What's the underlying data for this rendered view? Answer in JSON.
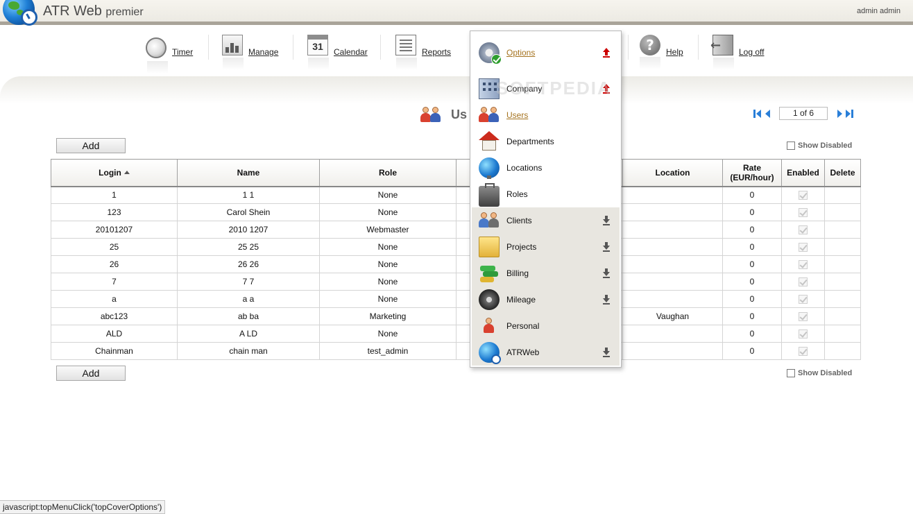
{
  "app": {
    "title": "ATR Web",
    "title_suffix": "premier",
    "user": "admin admin"
  },
  "nav": {
    "timer": "Timer",
    "manage": "Manage",
    "calendar": "Calendar",
    "calendar_day": "31",
    "reports": "Reports",
    "options": "Options",
    "help": "Help",
    "help_glyph": "?",
    "logoff": "Log off"
  },
  "page": {
    "title": "Us"
  },
  "pager": {
    "value": "1 of 6"
  },
  "actions": {
    "add_label": "Add",
    "show_disabled_label": "Show Disabled"
  },
  "table": {
    "headers": {
      "login": "Login",
      "name": "Name",
      "role": "Role",
      "location": "Location",
      "rate_line1": "Rate",
      "rate_line2": "(EUR/hour)",
      "enabled": "Enabled",
      "delete": "Delete"
    },
    "rows": [
      {
        "login": "1",
        "name": "1 1",
        "role": "None",
        "location": "",
        "rate": "0"
      },
      {
        "login": "123",
        "name": "Carol Shein",
        "role": "None",
        "location": "",
        "rate": "0"
      },
      {
        "login": "20101207",
        "name": "2010 1207",
        "role": "Webmaster",
        "location": "",
        "rate": "0"
      },
      {
        "login": "25",
        "name": "25 25",
        "role": "None",
        "location": "",
        "rate": "0"
      },
      {
        "login": "26",
        "name": "26 26",
        "role": "None",
        "location": "",
        "rate": "0"
      },
      {
        "login": "7",
        "name": "7 7",
        "role": "None",
        "location": "",
        "rate": "0"
      },
      {
        "login": "a",
        "name": "a a",
        "role": "None",
        "location": "",
        "rate": "0"
      },
      {
        "login": "abc123",
        "name": "ab ba",
        "role": "Marketing",
        "location": "Vaughan",
        "rate": "0"
      },
      {
        "login": "ALD",
        "name": "A LD",
        "role": "None",
        "location": "",
        "rate": "0"
      },
      {
        "login": "Chainman",
        "name": "chain man",
        "role": "test_admin",
        "location": "",
        "rate": "0"
      }
    ]
  },
  "options_menu": {
    "items": [
      {
        "label": "Options",
        "icon": "gear-check-icon"
      },
      {
        "label": "Company",
        "icon": "building-icon"
      },
      {
        "label": "Users",
        "icon": "users-icon"
      },
      {
        "label": "Departments",
        "icon": "house-icon"
      },
      {
        "label": "Locations",
        "icon": "globe-icon"
      },
      {
        "label": "Roles",
        "icon": "briefcase-icon"
      },
      {
        "label": "Clients",
        "icon": "clients-icon"
      },
      {
        "label": "Projects",
        "icon": "folder-gear-icon"
      },
      {
        "label": "Billing",
        "icon": "money-icon"
      },
      {
        "label": "Mileage",
        "icon": "tire-icon"
      },
      {
        "label": "Personal",
        "icon": "person-icon"
      },
      {
        "label": "ATRWeb",
        "icon": "atrweb-globe-icon"
      }
    ]
  },
  "watermark": "SOFTPEDIA",
  "status_bar": "javascript:topMenuClick('topCoverOptions')",
  "colors": {
    "menu_link": "#a5731f",
    "expand_arrow": "#cc0000",
    "pager_blue": "#2a7fd8",
    "header_band": "#a9a499"
  }
}
